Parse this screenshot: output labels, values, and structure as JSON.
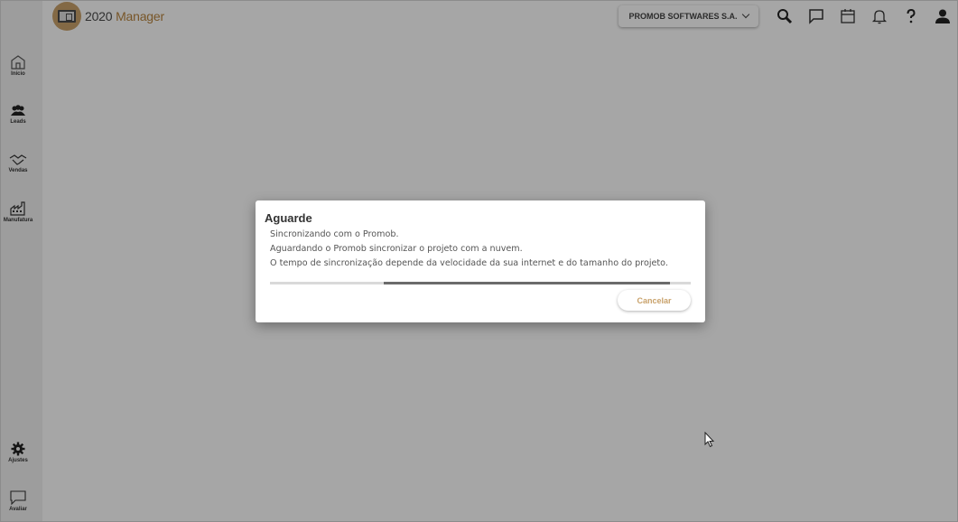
{
  "app": {
    "logo_text_part1": "2020",
    "logo_text_part2": "Manager",
    "company_selector": "PROMOB SOFTWARES S.A."
  },
  "topbar": {
    "icons": [
      "search-icon",
      "chat-icon",
      "calendar-icon",
      "bell-icon",
      "help-icon",
      "user-icon"
    ]
  },
  "sidebar": {
    "items": [
      {
        "label": "Início",
        "icon": "home-icon"
      },
      {
        "label": "Leads",
        "icon": "people-icon"
      },
      {
        "label": "Vendas",
        "icon": "handshake-icon"
      },
      {
        "label": "Manufatura",
        "icon": "factory-icon"
      },
      {
        "label": "Ajustes",
        "icon": "gear-icon"
      },
      {
        "label": "Avaliar",
        "icon": "feedback-icon"
      }
    ]
  },
  "dialog": {
    "title": "Aguarde",
    "lines": [
      "Sincronizando com o Promob.",
      "Aguardando o Promob sincronizar o projeto com a nuvem.",
      "O tempo de sincronização depende da velocidade da sua internet e do tamanho do projeto."
    ],
    "progress_start": 0.27,
    "progress_end": 0.95,
    "cancel_label": "Cancelar"
  },
  "colors": {
    "accent": "#c9a26b",
    "overlay": "#000000"
  }
}
